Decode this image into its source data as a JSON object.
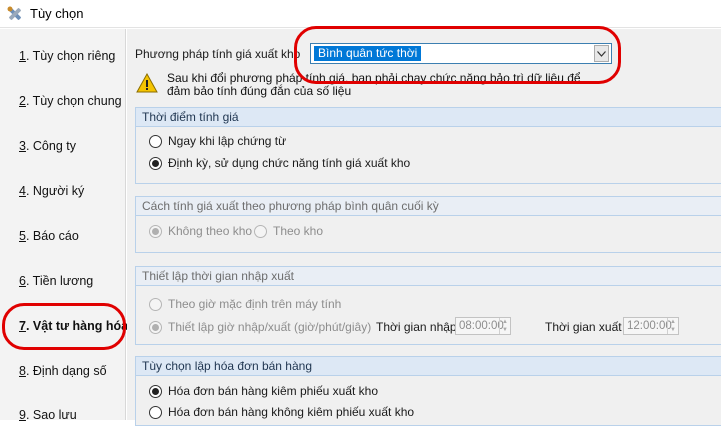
{
  "window": {
    "title": "Tùy chọn"
  },
  "sidebar": {
    "items": [
      {
        "num": "1",
        "label": ". Tùy chọn riêng"
      },
      {
        "num": "2",
        "label": ". Tùy chọn chung"
      },
      {
        "num": "3",
        "label": ". Công ty"
      },
      {
        "num": "4",
        "label": ". Người ký"
      },
      {
        "num": "5",
        "label": ". Báo cáo"
      },
      {
        "num": "6",
        "label": ". Tiền lương"
      },
      {
        "num": "7",
        "label": ". Vật tư hàng hóa"
      },
      {
        "num": "8",
        "label": ". Định dạng số"
      },
      {
        "num": "9",
        "label": ". Sao lưu"
      }
    ],
    "active_index": 6
  },
  "pricing": {
    "method_label": "Phương pháp tính giá xuất kho",
    "method_value": "Bình quân tức thời",
    "warning_text": "Sau khi đổi phương pháp tính giá, bạn phải chạy chức năng bảo trì dữ liệu để đảm bảo tính đúng đắn của số liệu"
  },
  "group_timing": {
    "title": "Thời điểm tính giá",
    "options": [
      "Ngay khi lập chứng từ",
      "Định kỳ, sử dụng chức năng tính giá xuất kho"
    ],
    "selected": 1
  },
  "group_period_avg": {
    "title": "Cách tính giá xuất theo phương pháp bình quân cuối kỳ",
    "options": [
      "Không theo kho",
      "Theo kho"
    ],
    "selected": 0
  },
  "group_time": {
    "title": "Thiết lập thời gian nhập xuất",
    "options": [
      "Theo giờ mặc định trên máy tính",
      "Thiết lập giờ nhập/xuất (giờ/phút/giây)"
    ],
    "selected": 1,
    "import_time_label": "Thời gian nhập",
    "import_time_value": "08:00:00",
    "export_time_label": "Thời gian xuất",
    "export_time_value": "12:00:00"
  },
  "group_invoice": {
    "title": "Tùy chọn lập hóa đơn bán hàng",
    "options": [
      "Hóa đơn bán hàng kiêm phiếu xuất kho",
      "Hóa đơn bán hàng không kiêm phiếu xuất kho"
    ],
    "selected": 0
  },
  "colors": {
    "highlight": "#e00000",
    "selection": "#0078d7",
    "group_border": "#b9d1ea"
  },
  "icons": {
    "app": "settings-tools-icon",
    "warning": "warning-triangle-icon"
  }
}
